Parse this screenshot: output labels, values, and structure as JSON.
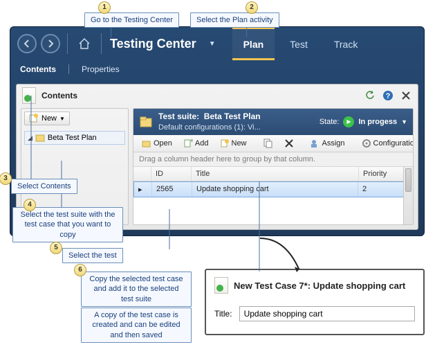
{
  "callouts": {
    "c1": "Go to the Testing Center",
    "c2": "Select the Plan activity",
    "c3": "Select Contents",
    "c4": "Select the test suite with the test case that you want to copy",
    "c5": "Select the test",
    "c6": "Copy the selected test case and add it to the selected test suite",
    "note": "A copy of the test case is created and can be edited and then saved"
  },
  "app": {
    "title": "Testing Center",
    "tabs": {
      "plan": "Plan",
      "test": "Test",
      "track": "Track"
    },
    "subtabs": {
      "contents": "Contents",
      "properties": "Properties"
    }
  },
  "panel": {
    "title": "Contents",
    "new_label": "New",
    "tree_item": "Beta Test Plan"
  },
  "suite": {
    "title_prefix": "Test suite:",
    "title_name": "Beta Test Plan",
    "subtitle": "Default configurations (1): Vi...",
    "state_label": "State:",
    "state_value": "In progess"
  },
  "toolbar": {
    "open": "Open",
    "add": "Add",
    "new": "New",
    "assign": "Assign",
    "configs": "Configurations"
  },
  "grid": {
    "group_hint": "Drag a column header here to group by that column.",
    "headers": {
      "id": "ID",
      "title": "Title",
      "priority": "Priority"
    },
    "row": {
      "id": "2565",
      "title": "Update shopping cart",
      "priority": "2"
    }
  },
  "newcase": {
    "heading": "New Test Case 7*: Update shopping cart",
    "title_label": "Title:",
    "title_value": "Update shopping cart"
  }
}
